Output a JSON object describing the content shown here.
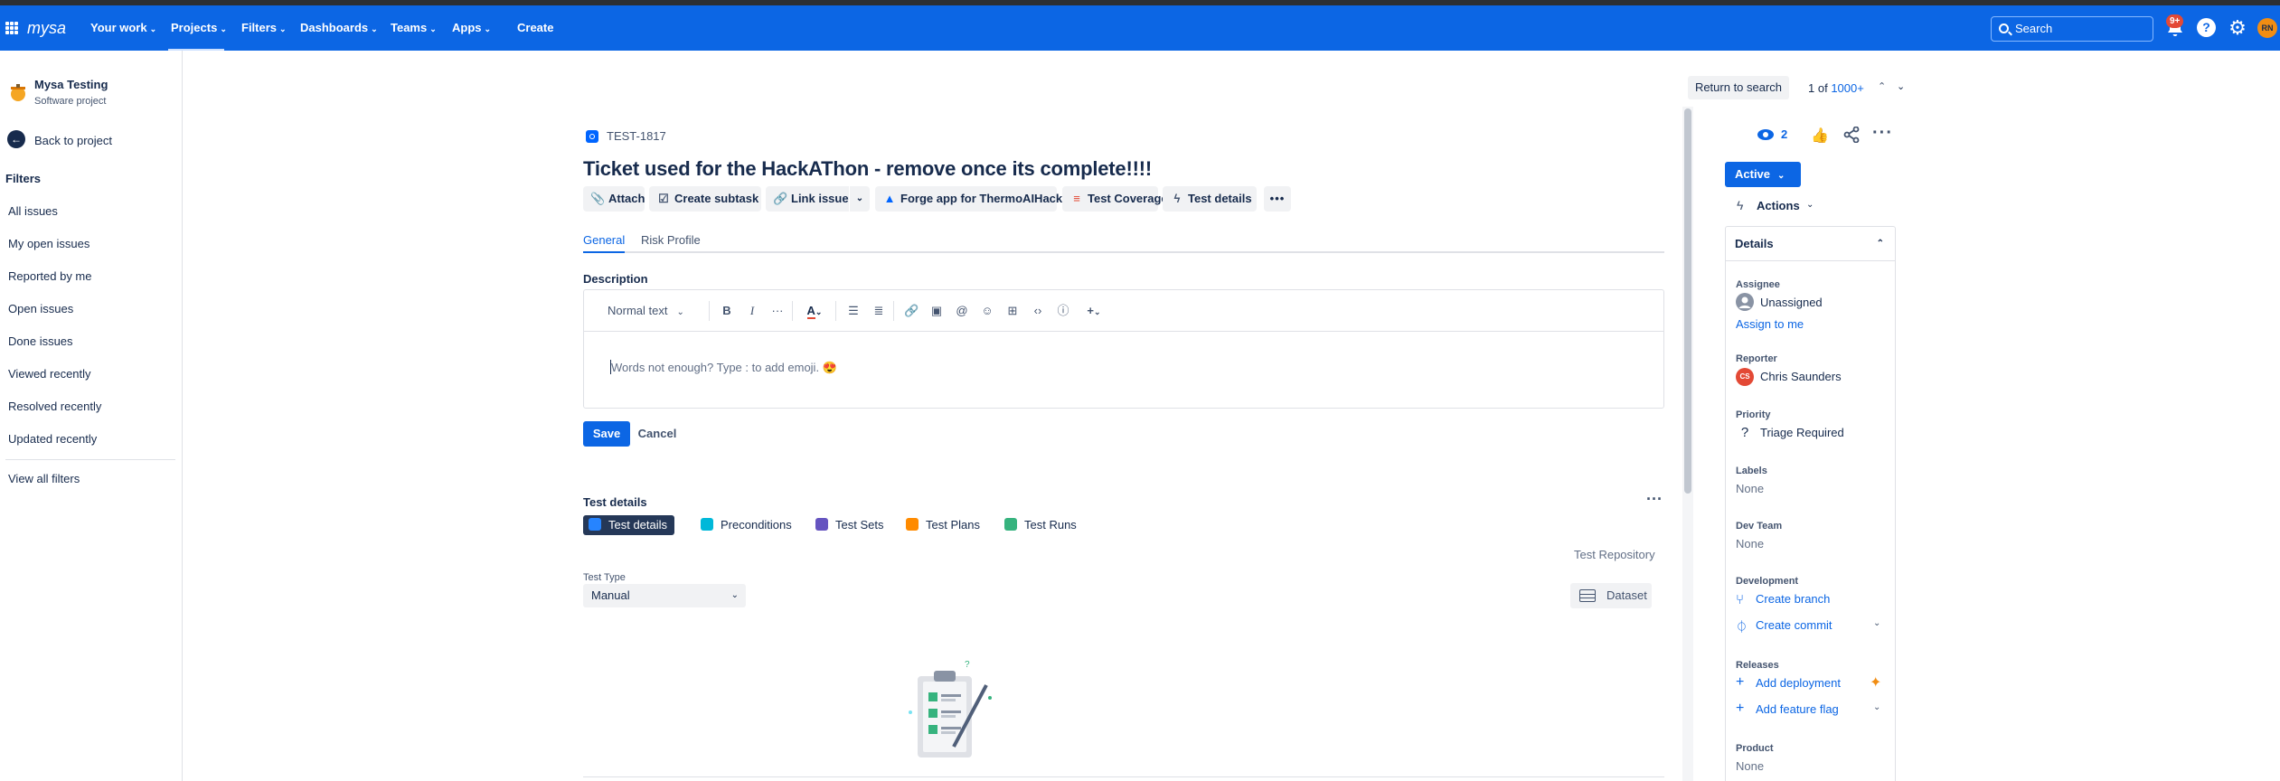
{
  "topnav": {
    "logo": "mysa",
    "items": [
      {
        "label": "Your work",
        "dropdown": true
      },
      {
        "label": "Projects",
        "dropdown": true
      },
      {
        "label": "Filters",
        "dropdown": true
      },
      {
        "label": "Dashboards",
        "dropdown": true
      },
      {
        "label": "Teams",
        "dropdown": true
      },
      {
        "label": "Apps",
        "dropdown": true
      }
    ],
    "create_label": "Create",
    "search_placeholder": "Search",
    "notifications_badge": "9+",
    "help_glyph": "?",
    "avatar_initials": "RN",
    "brand_color": "#0c66e4"
  },
  "sidebar": {
    "project_name": "Mysa Testing",
    "project_type": "Software project",
    "back_label": "Back to project",
    "filters_heading": "Filters",
    "items": [
      "All issues",
      "My open issues",
      "Reported by me",
      "Open issues",
      "Done issues",
      "Viewed recently",
      "Resolved recently",
      "Updated recently"
    ],
    "view_all": "View all filters"
  },
  "issue": {
    "key": "TEST-1817",
    "title": "Ticket used for the HackAThon - remove once its complete!!!!",
    "toolbar": {
      "attach": "Attach",
      "create_subtask": "Create subtask",
      "link_issue": "Link issue",
      "forge_app": "Forge app for ThermoAIHack",
      "test_coverage": "Test Coverage",
      "test_details": "Test details"
    },
    "tabs": [
      "General",
      "Risk Profile"
    ],
    "description_label": "Description",
    "editor": {
      "text_style": "Normal text",
      "placeholder": "Words not enough? Type : to add emoji. 😍",
      "save": "Save",
      "cancel": "Cancel"
    },
    "test_details": {
      "heading": "Test details",
      "tabs": [
        {
          "label": "Test details",
          "color": "#2684ff"
        },
        {
          "label": "Preconditions",
          "color": "#00b8d9"
        },
        {
          "label": "Test Sets",
          "color": "#6554c0"
        },
        {
          "label": "Test Plans",
          "color": "#ff8b00"
        },
        {
          "label": "Test Runs",
          "color": "#36b37e"
        }
      ],
      "repository": "Test Repository",
      "test_type_label": "Test Type",
      "test_type_value": "Manual",
      "dataset": "Dataset"
    }
  },
  "right_panel": {
    "return_to_search": "Return to search",
    "pager_prefix": "1 of",
    "pager_total": "1000+",
    "watchers": "2",
    "status": "Active",
    "actions": "Actions",
    "details": {
      "heading": "Details",
      "assignee_label": "Assignee",
      "assignee": "Unassigned",
      "assign_to_me": "Assign to me",
      "reporter_label": "Reporter",
      "reporter_initials": "CS",
      "reporter": "Chris Saunders",
      "priority_label": "Priority",
      "priority": "Triage Required",
      "labels_label": "Labels",
      "labels": "None",
      "dev_team_label": "Dev Team",
      "dev_team": "None",
      "development_label": "Development",
      "create_branch": "Create branch",
      "create_commit": "Create commit",
      "releases_label": "Releases",
      "add_deployment": "Add deployment",
      "add_feature_flag": "Add feature flag",
      "product_label": "Product",
      "product": "None"
    }
  }
}
